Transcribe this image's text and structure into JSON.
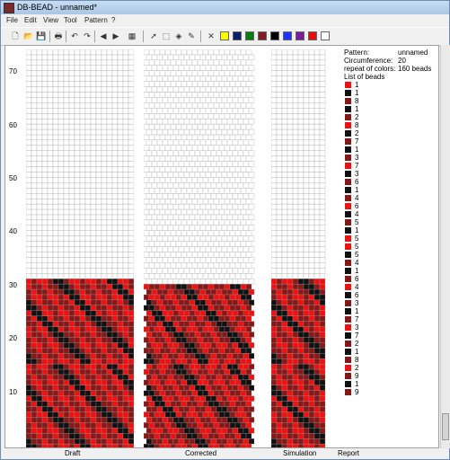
{
  "window": {
    "title": "DB-BEAD - unnamed*"
  },
  "menu": [
    "File",
    "Edit",
    "View",
    "Tool",
    "Pattern",
    "?"
  ],
  "toolbar": {
    "icons": [
      "new-file-icon",
      "open-folder-icon",
      "save-icon",
      "print-icon",
      "undo-icon",
      "redo-icon",
      "arrow-left-icon",
      "arrow-right-icon",
      "preview-icon",
      "pointer-icon",
      "select-rect-icon",
      "fill-icon",
      "eyedropper-icon",
      "delete-color-icon"
    ],
    "colors": [
      "#ffff00",
      "#0b1e6e",
      "#0a7d10",
      "#7a1e1e",
      "#000000",
      "#1f33ff",
      "#7a1e9e",
      "#e01010",
      "#ffffff"
    ]
  },
  "palette": {
    "red": "#ee1111",
    "dark": "#881818",
    "black": "#111111",
    "empty": "#ffffff"
  },
  "ruler": [
    "70",
    "60",
    "50",
    "40",
    "30",
    "20",
    "10"
  ],
  "panels": {
    "draft": "Draft",
    "corrected": "Corrected",
    "simulation": "Simulation",
    "report": "Report"
  },
  "report": {
    "pattern_label": "Pattern:",
    "pattern_value": "unnamed",
    "circ_label": "Circumference:",
    "circ_value": "20",
    "repeat_label": "repeat of colors:",
    "repeat_value": "160 beads",
    "list_label": "List of beads",
    "beads": [
      {
        "c": "red",
        "n": "1"
      },
      {
        "c": "black",
        "n": "1"
      },
      {
        "c": "dark",
        "n": "8"
      },
      {
        "c": "black",
        "n": "1"
      },
      {
        "c": "dark",
        "n": "2"
      },
      {
        "c": "red",
        "n": "8"
      },
      {
        "c": "black",
        "n": "2"
      },
      {
        "c": "dark",
        "n": "7"
      },
      {
        "c": "black",
        "n": "1"
      },
      {
        "c": "dark",
        "n": "3"
      },
      {
        "c": "red",
        "n": "7"
      },
      {
        "c": "black",
        "n": "3"
      },
      {
        "c": "dark",
        "n": "6"
      },
      {
        "c": "black",
        "n": "1"
      },
      {
        "c": "dark",
        "n": "4"
      },
      {
        "c": "red",
        "n": "6"
      },
      {
        "c": "black",
        "n": "4"
      },
      {
        "c": "dark",
        "n": "5"
      },
      {
        "c": "black",
        "n": "1"
      },
      {
        "c": "red",
        "n": "5"
      },
      {
        "c": "red",
        "n": "5"
      },
      {
        "c": "black",
        "n": "5"
      },
      {
        "c": "dark",
        "n": "4"
      },
      {
        "c": "black",
        "n": "1"
      },
      {
        "c": "dark",
        "n": "6"
      },
      {
        "c": "red",
        "n": "4"
      },
      {
        "c": "black",
        "n": "6"
      },
      {
        "c": "dark",
        "n": "3"
      },
      {
        "c": "black",
        "n": "1"
      },
      {
        "c": "dark",
        "n": "7"
      },
      {
        "c": "red",
        "n": "3"
      },
      {
        "c": "black",
        "n": "7"
      },
      {
        "c": "dark",
        "n": "2"
      },
      {
        "c": "black",
        "n": "1"
      },
      {
        "c": "dark",
        "n": "8"
      },
      {
        "c": "red",
        "n": "2"
      },
      {
        "c": "dark",
        "n": "9"
      },
      {
        "c": "black",
        "n": "1"
      },
      {
        "c": "dark",
        "n": "9"
      }
    ]
  }
}
